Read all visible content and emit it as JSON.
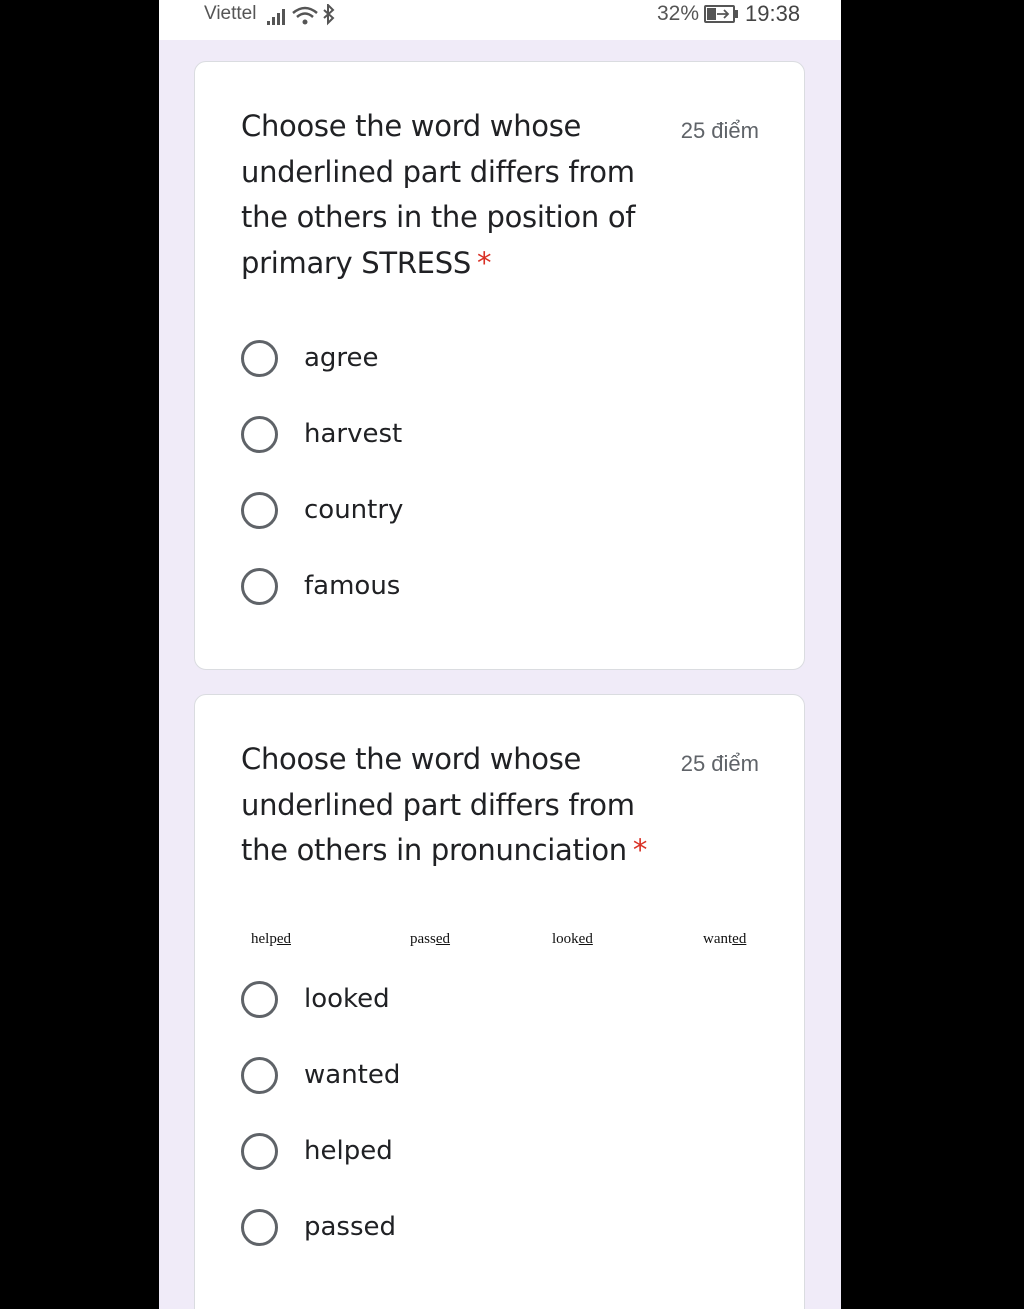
{
  "status_bar": {
    "carrier": "Viettel",
    "battery_percent": "32%",
    "time": "19:38"
  },
  "questions": [
    {
      "title": "Choose the word whose underlined part differs from the others in the position of primary STRESS",
      "required_marker": "*",
      "points": "25 điểm",
      "options": [
        "agree",
        "harvest",
        "country",
        "famous"
      ]
    },
    {
      "title": "Choose the word whose underlined part differs from the others in pronunciation",
      "required_marker": "*",
      "points": "25 điểm",
      "image_words": [
        {
          "stem": "help",
          "underlined": "ed"
        },
        {
          "stem": "pass",
          "underlined": "ed"
        },
        {
          "stem": "look",
          "underlined": "ed"
        },
        {
          "stem": "want",
          "underlined": "ed"
        }
      ],
      "options": [
        "looked",
        "wanted",
        "helped",
        "passed"
      ]
    }
  ]
}
